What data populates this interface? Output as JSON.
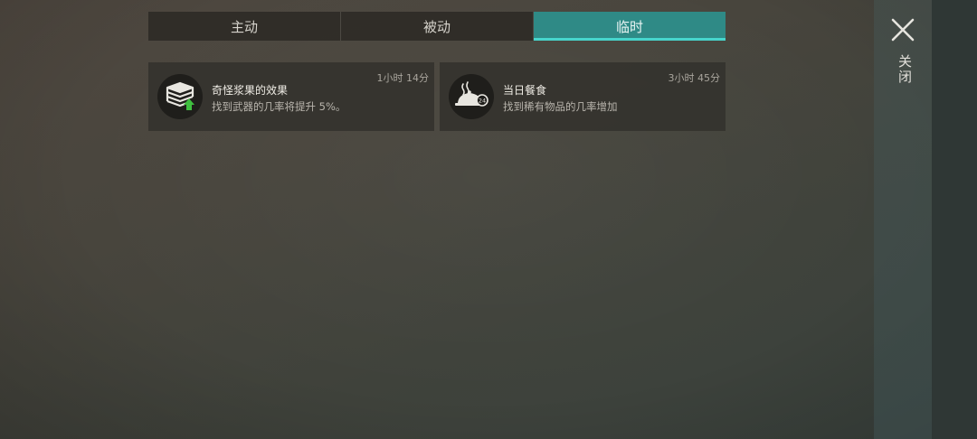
{
  "tabs": [
    {
      "label": "主动",
      "active": false
    },
    {
      "label": "被动",
      "active": false
    },
    {
      "label": "临时",
      "active": true
    }
  ],
  "cards": [
    {
      "icon": "books-upgrade-icon",
      "title": "奇怪浆果的效果",
      "description": "找到武器的几率将提升 5%。",
      "time_left": "1小时 14分"
    },
    {
      "icon": "food-cloche-24h-icon",
      "title": "当日餐食",
      "description": "找到稀有物品的几率增加",
      "time_left": "3小时 45分"
    }
  ],
  "close": {
    "label": "关闭",
    "icon": "close-icon"
  },
  "colors": {
    "active_tab": "#2f8a86",
    "active_tab_underline": "#47d5cc",
    "upgrade_arrow": "#3fbf3f"
  }
}
